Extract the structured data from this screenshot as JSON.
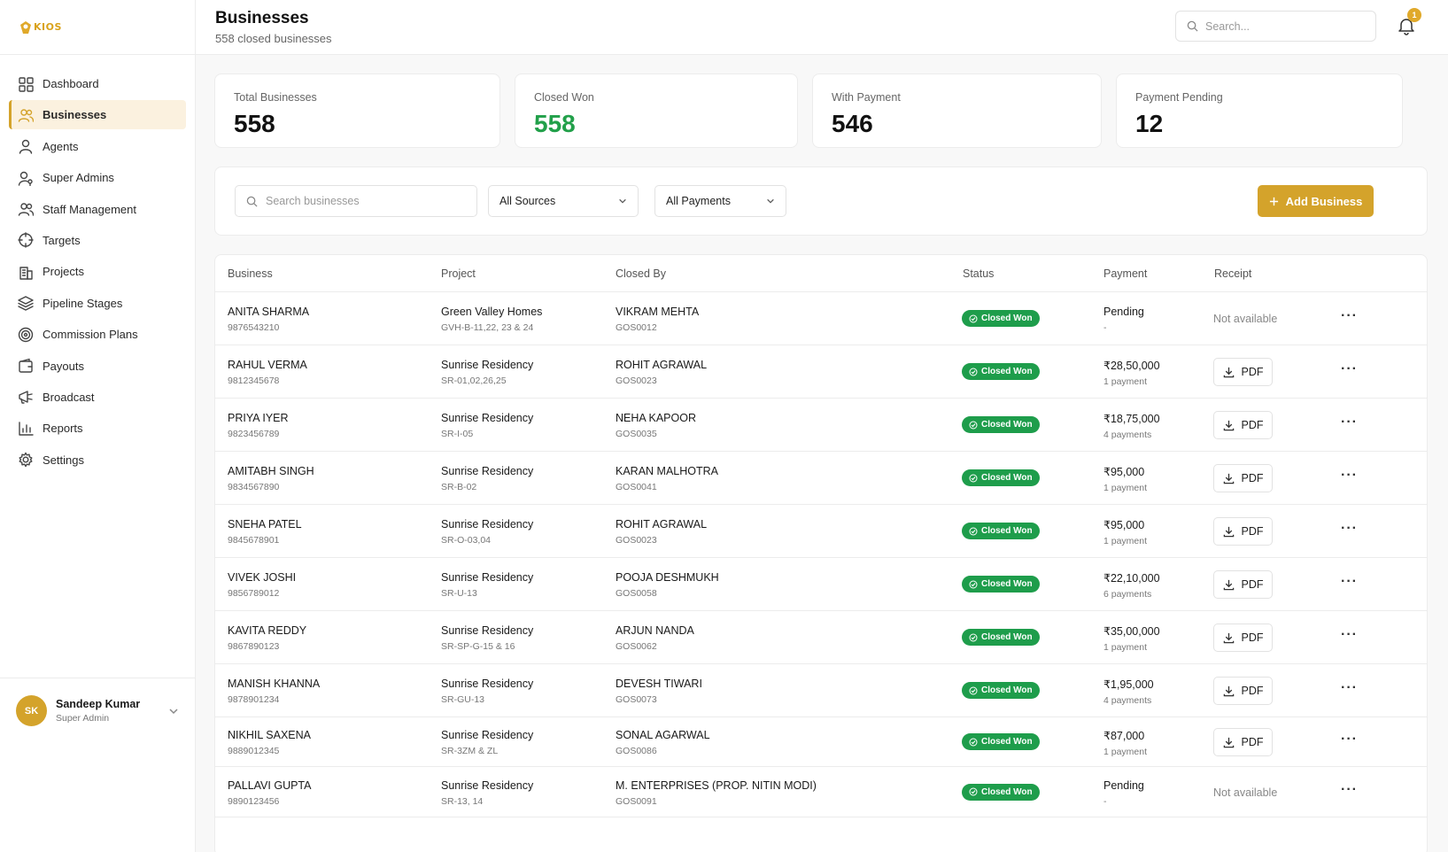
{
  "brand": {
    "logo_text": "KIOS"
  },
  "sidebar": {
    "items": [
      {
        "label": "Dashboard",
        "icon": "grid-icon",
        "active": false
      },
      {
        "label": "Businesses",
        "icon": "users-icon",
        "active": true
      },
      {
        "label": "Agents",
        "icon": "user-icon",
        "active": false
      },
      {
        "label": "Super Admins",
        "icon": "user-key-icon",
        "active": false
      },
      {
        "label": "Staff Management",
        "icon": "users-icon",
        "active": false
      },
      {
        "label": "Targets",
        "icon": "crosshair-icon",
        "active": false
      },
      {
        "label": "Projects",
        "icon": "building-icon",
        "active": false
      },
      {
        "label": "Pipeline Stages",
        "icon": "layers-icon",
        "active": false
      },
      {
        "label": "Commission Plans",
        "icon": "target-icon",
        "active": false
      },
      {
        "label": "Payouts",
        "icon": "wallet-icon",
        "active": false
      },
      {
        "label": "Broadcast",
        "icon": "megaphone-icon",
        "active": false
      },
      {
        "label": "Reports",
        "icon": "bar-chart-icon",
        "active": false
      },
      {
        "label": "Settings",
        "icon": "gear-icon",
        "active": false
      }
    ],
    "user": {
      "initials": "SK",
      "name": "Sandeep Kumar",
      "role": "Super Admin"
    }
  },
  "header": {
    "title": "Businesses",
    "subtitle": "558 closed businesses",
    "search_placeholder": "Search...",
    "notification_count": "1"
  },
  "stats": [
    {
      "label": "Total Businesses",
      "value": "558"
    },
    {
      "label": "Closed Won",
      "value": "558"
    },
    {
      "label": "With Payment",
      "value": "546"
    },
    {
      "label": "Payment Pending",
      "value": "12"
    }
  ],
  "filters": {
    "search_placeholder": "Search businesses",
    "source_select": "All Sources",
    "payment_select": "All Payments",
    "add_button": "Add Business"
  },
  "table": {
    "columns": [
      "Business",
      "Project",
      "Closed By",
      "Status",
      "Payment",
      "Receipt"
    ],
    "rows": [
      {
        "name": "ANITA SHARMA",
        "phone": "9876543210",
        "project": "Green Valley Homes",
        "unit": "GVH-B-11,22, 23 & 24",
        "closer": "VIKRAM MEHTA",
        "closer_id": "GOS0012",
        "status": "Closed Won",
        "payment": "Pending",
        "payment_sub": "-",
        "receipt": "Not available"
      },
      {
        "name": "RAHUL VERMA",
        "phone": "9812345678",
        "project": "Sunrise Residency",
        "unit": "SR-01,02,26,25",
        "closer": "ROHIT AGRAWAL",
        "closer_id": "GOS0023",
        "status": "Closed Won",
        "payment": "₹28,50,000",
        "payment_sub": "1 payment",
        "receipt": "PDF"
      },
      {
        "name": "PRIYA IYER",
        "phone": "9823456789",
        "project": "Sunrise Residency",
        "unit": "SR-I-05",
        "closer": "NEHA KAPOOR",
        "closer_id": "GOS0035",
        "status": "Closed Won",
        "payment": "₹18,75,000",
        "payment_sub": "4 payments",
        "receipt": "PDF"
      },
      {
        "name": "AMITABH SINGH",
        "phone": "9834567890",
        "project": "Sunrise Residency",
        "unit": "SR-B-02",
        "closer": "KARAN MALHOTRA",
        "closer_id": "GOS0041",
        "status": "Closed Won",
        "payment": "₹95,000",
        "payment_sub": "1 payment",
        "receipt": "PDF"
      },
      {
        "name": "SNEHA PATEL",
        "phone": "9845678901",
        "project": "Sunrise Residency",
        "unit": "SR-O-03,04",
        "closer": "ROHIT AGRAWAL",
        "closer_id": "GOS0023",
        "status": "Closed Won",
        "payment": "₹95,000",
        "payment_sub": "1 payment",
        "receipt": "PDF"
      },
      {
        "name": "VIVEK JOSHI",
        "phone": "9856789012",
        "project": "Sunrise Residency",
        "unit": "SR-U-13",
        "closer": "POOJA DESHMUKH",
        "closer_id": "GOS0058",
        "status": "Closed Won",
        "payment": "₹22,10,000",
        "payment_sub": "6 payments",
        "receipt": "PDF"
      },
      {
        "name": "KAVITA REDDY",
        "phone": "9867890123",
        "project": "Sunrise Residency",
        "unit": "SR-SP-G-15 & 16",
        "closer": "ARJUN NANDA",
        "closer_id": "GOS0062",
        "status": "Closed Won",
        "payment": "₹35,00,000",
        "payment_sub": "1 payment",
        "receipt": "PDF"
      },
      {
        "name": "MANISH KHANNA",
        "phone": "9878901234",
        "project": "Sunrise Residency",
        "unit": "SR-GU-13",
        "closer": "DEVESH TIWARI",
        "closer_id": "GOS0073",
        "status": "Closed Won",
        "payment": "₹1,95,000",
        "payment_sub": "4 payments",
        "receipt": "PDF"
      },
      {
        "name": "NIKHIL SAXENA",
        "phone": "9889012345",
        "project": "Sunrise Residency",
        "unit": "SR-3ZM & ZL",
        "closer": "SONAL AGARWAL",
        "closer_id": "GOS0086",
        "status": "Closed Won",
        "payment": "₹87,000",
        "payment_sub": "1 payment",
        "receipt": "PDF"
      },
      {
        "name": "PALLAVI GUPTA",
        "phone": "9890123456",
        "project": "Sunrise Residency",
        "unit": "SR-13, 14",
        "closer": "M. ENTERPRISES (PROP. NITIN MODI)",
        "closer_id": "GOS0091",
        "status": "Closed Won",
        "payment": "Pending",
        "payment_sub": "-",
        "receipt": "Not available"
      }
    ]
  },
  "colors": {
    "accent": "#d4a32b",
    "success": "#1e9d4b",
    "stat_green": "#22a04a"
  }
}
